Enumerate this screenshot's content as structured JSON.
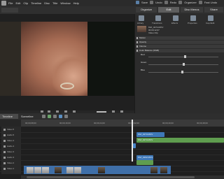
{
  "menubar": {
    "menus": [
      "File",
      "Edit",
      "Clip",
      "Timeline",
      "Disc",
      "Title",
      "Window",
      "Help"
    ],
    "right_tools": [
      "Undo",
      "Redo",
      "Organizer",
      "Fast Undo"
    ],
    "save_label": "Save"
  },
  "tabs": [
    "Organize",
    "Edit",
    "Disc Menus",
    "Share"
  ],
  "right_panel": {
    "icons": [
      "Library",
      "Transitions",
      "Effects",
      "Properties",
      "Cap./Edit"
    ],
    "clip": {
      "name": "MVI_0274.MOV",
      "info1": "00;00;12;07",
      "info2": "Video Clip"
    },
    "sections": [
      "Motion",
      "Opacity",
      "Volume",
      "Color Balance (RGB)"
    ],
    "props": [
      "Red",
      "Green",
      "Blue"
    ],
    "slider_values": [
      0.52,
      0.5,
      0.48
    ]
  },
  "timeline": {
    "title": "Timeline",
    "sub_tab": "Sceneline",
    "ruler_marks": [
      "00;00;08;00",
      "00;00;16;00",
      "00;00;24;00",
      "00;00;32;00",
      "00;00;40;00",
      "00;00;48;00"
    ],
    "tracks": [
      {
        "name": "Video 5"
      },
      {
        "name": "Audio 5"
      },
      {
        "name": "Video 4"
      },
      {
        "name": "Audio 4"
      },
      {
        "name": "Video 3"
      },
      {
        "name": "Audio 3"
      },
      {
        "name": "Video 2"
      },
      {
        "name": "Audio 2"
      },
      {
        "name": "Video 1"
      }
    ],
    "clips": {
      "v3": "MVI_0274.MOV",
      "a3": "MVI_0274.MOV",
      "v2": "MVI_0262.MOV"
    }
  }
}
